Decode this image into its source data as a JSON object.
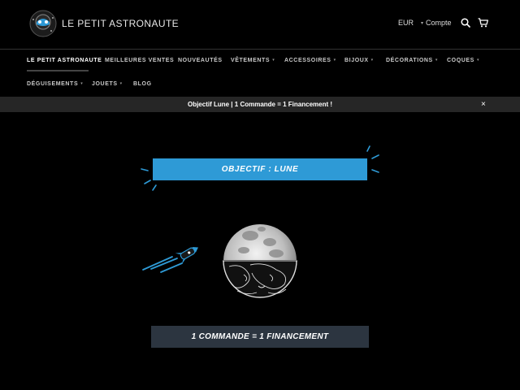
{
  "header": {
    "brand": "LE PETIT ASTRONAUTE",
    "currency": "EUR",
    "currency_caret": "▾",
    "account": "Compte"
  },
  "nav": {
    "items": [
      {
        "label": "LE PETIT ASTRONAUTE",
        "has_dropdown": false
      },
      {
        "label": "MEILLEURES VENTES",
        "has_dropdown": false
      },
      {
        "label": "NOUVEAUTÉS",
        "has_dropdown": false
      },
      {
        "label": "VÊTEMENTS",
        "has_dropdown": true
      },
      {
        "label": "ACCESSOIRES",
        "has_dropdown": true
      },
      {
        "label": "BIJOUX",
        "has_dropdown": true
      },
      {
        "label": "DÉCORATIONS",
        "has_dropdown": true
      },
      {
        "label": "COQUES",
        "has_dropdown": true
      },
      {
        "label": "DÉGUISEMENTS",
        "has_dropdown": true
      },
      {
        "label": "JOUETS",
        "has_dropdown": true
      },
      {
        "label": "BLOG",
        "has_dropdown": false
      }
    ],
    "chevron": "▾"
  },
  "announcement": {
    "text": "Objectif Lune | 1 Commande = 1 Financement !",
    "close": "×"
  },
  "hero": {
    "top_banner": "OBJECTIF : LUNE",
    "bottom_banner": "1 COMMANDE = 1 FINANCEMENT"
  },
  "colors": {
    "accent_blue": "#2e9ad6",
    "banner_dark": "#2c3540",
    "bar_bg": "#262626"
  }
}
